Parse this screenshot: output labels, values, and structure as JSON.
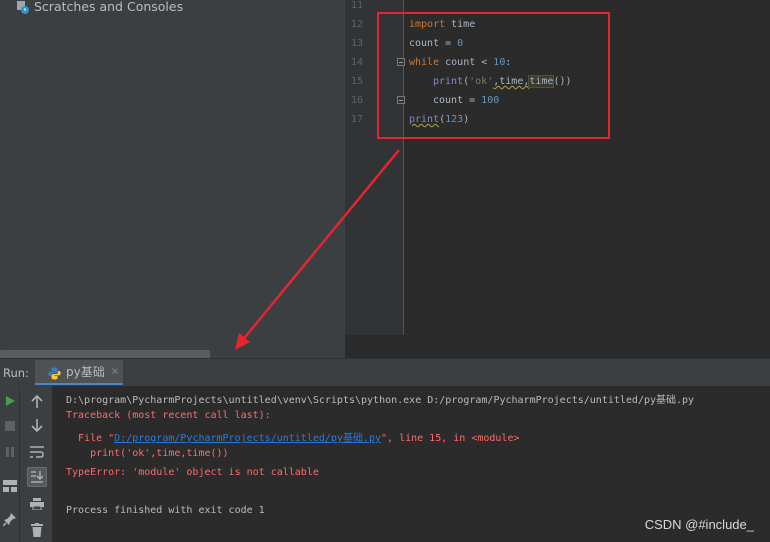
{
  "project_panel": {
    "scratches_label": "Scratches and Consoles"
  },
  "editor": {
    "line_numbers": [
      "11",
      "12",
      "13",
      "14",
      "15",
      "16",
      "17"
    ],
    "code": {
      "l12_kw": "import",
      "l12_rest": " time",
      "l13_a": "count = ",
      "l13_num": "0",
      "l14_kw": "while",
      "l14_a": " count < ",
      "l14_num": "10",
      "l14_b": ":",
      "l15_fn": "print",
      "l15_a": "(",
      "l15_str": "'ok'",
      "l15_b": ",time,",
      "l15_c": "time",
      "l15_d": "())",
      "l16_a": "count = ",
      "l16_num": "100",
      "l17_fn": "print",
      "l17_a": "(",
      "l17_num": "123",
      "l17_b": ")"
    }
  },
  "run_panel": {
    "label": "Run:",
    "tab_name": "py基础",
    "tab_close": "×"
  },
  "console": {
    "cmd": "D:\\program\\PycharmProjects\\untitled\\venv\\Scripts\\python.exe D:/program/PycharmProjects/untitled/py基础.py",
    "traceback": "Traceback (most recent call last):",
    "file_prefix": "  File \"",
    "file_link": "D:/program/PycharmProjects/untitled/py基础.py",
    "file_suffix": "\", line 15, in <module>",
    "code_line": "    print('ok',time,time())",
    "error": "TypeError: 'module' object is not callable",
    "finished": "Process finished with exit code 1"
  },
  "watermark": "CSDN @#include_",
  "colors": {
    "annotation_red": "#e3272f",
    "accent_blue": "#4a88c7",
    "error_red": "#ff6b68"
  }
}
